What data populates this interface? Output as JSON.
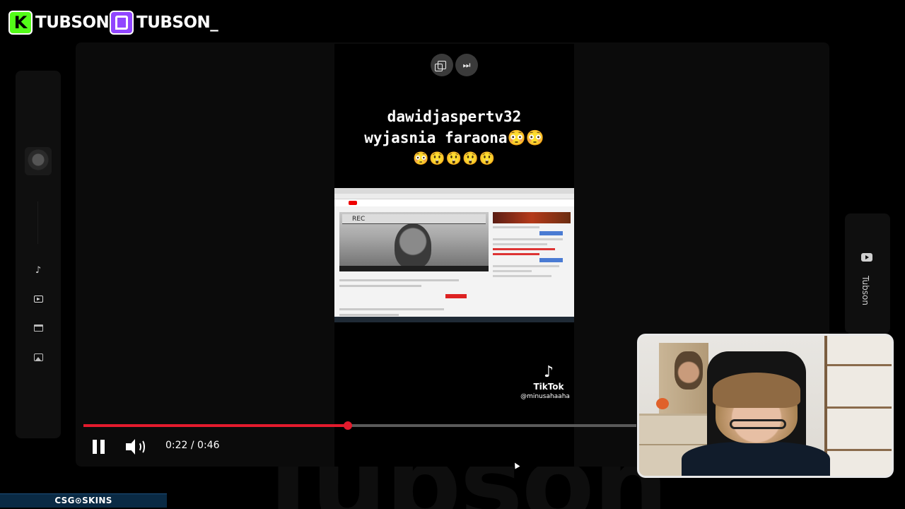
{
  "overlay": {
    "kick_handle": "TUBSON",
    "twitch_handle": "TUBSON_",
    "watermark": "Tubson",
    "sponsor": "CSG⊙SKINS"
  },
  "sidebar": {
    "items": [
      {
        "icon": "music-note-icon",
        "glyph": "♪"
      },
      {
        "icon": "video-icon"
      },
      {
        "icon": "clapperboard-icon"
      },
      {
        "icon": "image-icon"
      }
    ]
  },
  "channel_tab": {
    "icon": "youtube-icon",
    "name": "Tubson"
  },
  "video": {
    "caption_line1": "dawidjaspertv32",
    "caption_line2": "wyjasnia faraona😳😳",
    "caption_line3": "😳😲😲😲😲",
    "inner_rec_label": "REC",
    "tiktok_brand": "TikTok",
    "tiktok_user": "@minusahaaha",
    "tiktok_glyph": "♪"
  },
  "player": {
    "current_time": "0:22",
    "duration": "0:46",
    "time_display": "0:22 / 0:46",
    "progress_fraction": 0.4783,
    "accent_color": "#e31b2d"
  }
}
